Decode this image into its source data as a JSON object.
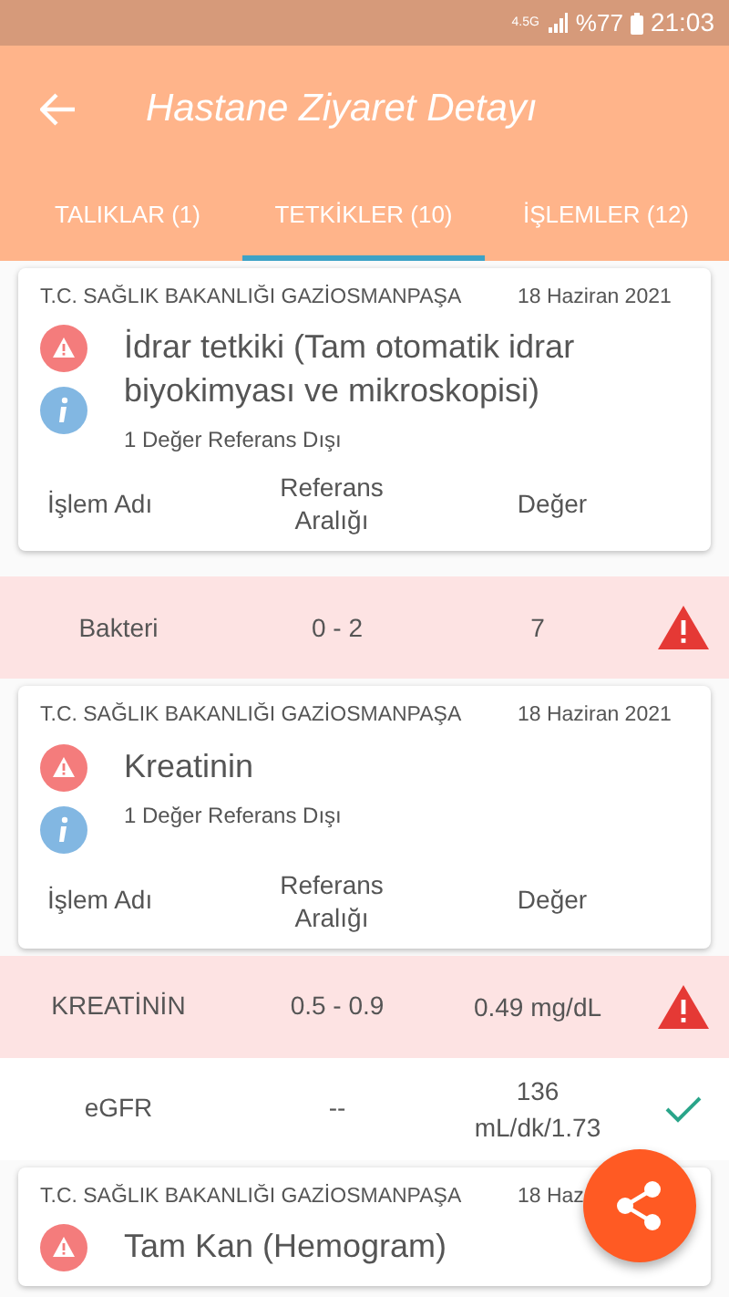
{
  "status_bar": {
    "network": "4.5G",
    "battery": "%77",
    "time": "21:03"
  },
  "app_bar": {
    "title": "Hastane Ziyaret Detayı"
  },
  "tabs": [
    {
      "label": "TALIKLAR (1)",
      "selected": false
    },
    {
      "label": "TETKİKLER (10)",
      "selected": true
    },
    {
      "label": "İŞLEMLER (12)",
      "selected": false
    }
  ],
  "results": [
    {
      "institution": "T.C. SAĞLIK BAKANLIĞI GAZİOSMANPAŞA",
      "date": "18 Haziran 2021",
      "test": "İdrar tetkiki (Tam otomatik idrar biyokimyası ve mikroskopisi)",
      "note": "1 Değer Referans Dışı",
      "columns": [
        "İşlem Adı",
        "Referans Aralığı",
        "Değer"
      ],
      "rows": [
        {
          "name": "Bakteri",
          "range": "0 - 2",
          "value": "7",
          "out_of_range": true
        }
      ]
    },
    {
      "institution": "T.C. SAĞLIK BAKANLIĞI GAZİOSMANPAŞA",
      "date": "18 Haziran 2021",
      "test": "Kreatinin",
      "note": "1 Değer Referans Dışı",
      "columns": [
        "İşlem Adı",
        "Referans Aralığı",
        "Değer"
      ],
      "rows": [
        {
          "name": "KREATİNİN",
          "range": "0.5 - 0.9",
          "value": "0.49 mg/dL",
          "out_of_range": true
        },
        {
          "name": "eGFR",
          "range": "--",
          "value": "136 mL/dk/1.73",
          "out_of_range": false
        }
      ]
    },
    {
      "institution": "T.C. SAĞLIK BAKANLIĞI GAZİOSMANPAŞA",
      "date": "18 Haz",
      "test": "Tam Kan (Hemogram)"
    }
  ]
}
